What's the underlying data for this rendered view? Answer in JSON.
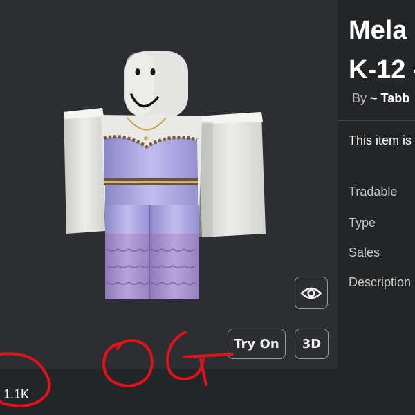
{
  "item": {
    "title_line1": "Mela",
    "title_line2": "K-12 -",
    "byline_prefix": "By",
    "creator": "~ Tabb",
    "notice": "This item is"
  },
  "details": {
    "labels": [
      "Tradable",
      "Type",
      "Sales",
      "Description"
    ]
  },
  "preview": {
    "try_on_label": "Try On",
    "threed_label": "3D",
    "eye_icon": "eye-icon"
  },
  "stats": {
    "favorites": "1.1K"
  },
  "annotation": {
    "handwritten_text": "OG",
    "color": "#e0121a"
  }
}
